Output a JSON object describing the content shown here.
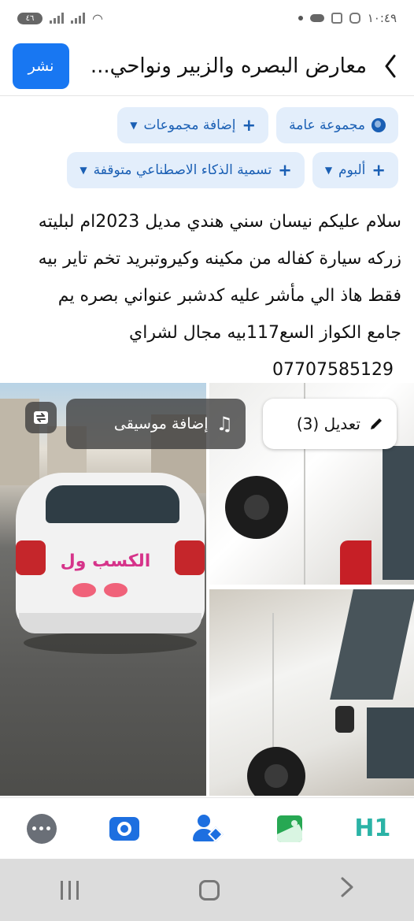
{
  "status_bar": {
    "time": "١٠:٤٩",
    "battery": "٤٦"
  },
  "header": {
    "title": "معارض البصره والزبير ونواحي...",
    "post_button": "نشر"
  },
  "chips_row1": {
    "audience": "مجموعة عامة",
    "add_groups": "إضافة مجموعات"
  },
  "chips_row2": {
    "album": "ألبوم",
    "ai_label": "تسمية الذكاء الاصطناعي متوقفة"
  },
  "post": {
    "lines": [
      "سلام عليكم نيسان سني هندي مديل 2023ام لبليته",
      "زركه سيارة كفاله من مكينه وكيروتبريد تخم تاير بيه",
      "فقط هاذ الي مأشر عليه كدشبر عنواني بصره يم",
      "جامع الكواز السع117بيه مجال لشراي"
    ],
    "phone": "07707585129"
  },
  "photos": {
    "sticker_text": "الكسب ول",
    "add_music": "إضافة موسيقى",
    "edit_label": "تعديل (3)"
  },
  "toolbar": {
    "icons": [
      "more-icon",
      "camera-icon",
      "tag-people-icon",
      "photo-icon",
      "heading-icon"
    ],
    "heading_label": "H1"
  },
  "system_nav": {
    "back_glyph": "〈"
  }
}
